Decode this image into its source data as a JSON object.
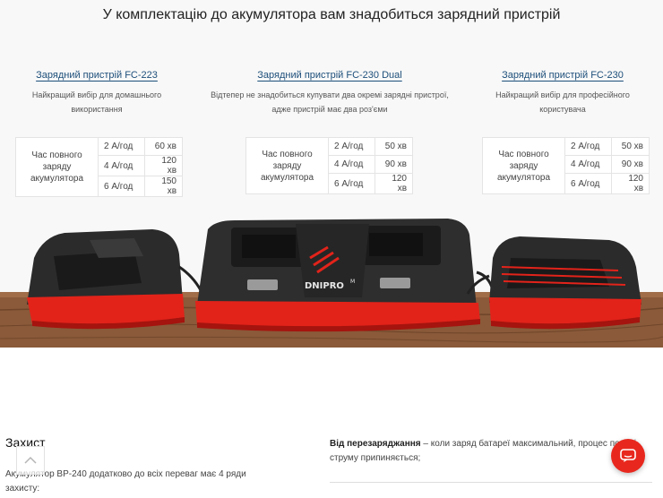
{
  "headline": "У комплектацію до акумулятора вам знадобиться зарядний пристрій",
  "chargers": [
    {
      "title": "Зарядний пристрій FC-223",
      "desc_line1": "Найкращий вибір для домашнього",
      "desc_line2": "використання",
      "label_lines": [
        "Час повного",
        "заряду",
        "акумулятора"
      ],
      "rows": [
        {
          "amp": "2 А/год",
          "time": "60 хв"
        },
        {
          "amp": "4 А/год",
          "time": "120 хв"
        },
        {
          "amp": "6 А/год",
          "time": "150 хв"
        }
      ]
    },
    {
      "title": "Зарядний пристрій FC-230 Dual",
      "desc_line1": "Відтепер не знадобиться купувати два окремі зарядні пристрої,",
      "desc_line2": "адже пристрій має два роз'єми",
      "label_lines": [
        "Час повного",
        "заряду",
        "акумулятора"
      ],
      "rows": [
        {
          "amp": "2 А/год",
          "time": "50 хв"
        },
        {
          "amp": "4 А/год",
          "time": "90 хв"
        },
        {
          "amp": "6 А/год",
          "time": "120 хв"
        }
      ]
    },
    {
      "title": "Зарядний пристрій FC-230",
      "desc_line1": "Найкращий вибір для професійного",
      "desc_line2": "користувача",
      "label_lines": [
        "Час повного",
        "заряду",
        "акумулятора"
      ],
      "rows": [
        {
          "amp": "2 А/год",
          "time": "50 хв"
        },
        {
          "amp": "4 А/год",
          "time": "90 хв"
        },
        {
          "amp": "6 А/год",
          "time": "120 хв"
        }
      ]
    }
  ],
  "photo_brand": "DNIPRO",
  "photo_brand_suffix": "M",
  "protection": {
    "title": "Захист",
    "intro": "Акумулятор BP-240 додатково до всіх переваг має 4 ряди захисту:",
    "item_bold": "Від перезаряджання",
    "item_text": " – коли заряд батареї максимальний, процес подачі струму припиняється;"
  },
  "colors": {
    "accent": "#e8281e",
    "link": "#1d4f7a"
  },
  "icons": {
    "scroll_top": "chevron-up-icon",
    "chat": "chat-icon"
  }
}
